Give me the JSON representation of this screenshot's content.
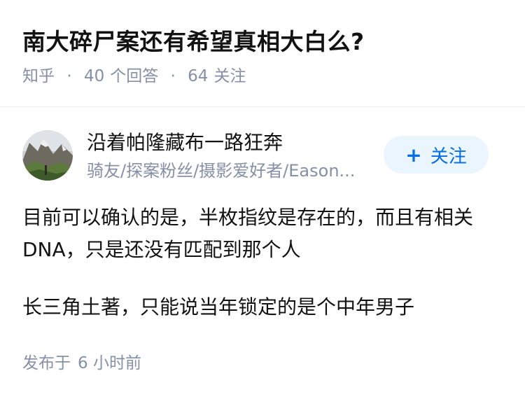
{
  "question": {
    "title": "南大碎尸案还有希望真相大白么?",
    "source": "知乎",
    "answers_count": "40",
    "answers_label": "个回答",
    "followers_count": "64",
    "followers_label": "关注",
    "separator": "·"
  },
  "author": {
    "name": "沿着帕隆藏布一路狂奔",
    "bio": "骑友/探案粉丝/摄影爱好者/Eason...",
    "avatar_icon": "mountain-landscape-avatar"
  },
  "follow_button": {
    "plus": "+",
    "label": "关注",
    "text_color": "#056de8",
    "bg_color": "#ebf5fd"
  },
  "answer": {
    "paragraphs": [
      "目前可以确认的是，半枚指纹是存在的，而且有相关DNA，只是还没有匹配到那个人",
      "长三角土著，只能说当年锁定的是个中年男子"
    ],
    "published_label": "发布于",
    "published_time": "6 小时前"
  }
}
